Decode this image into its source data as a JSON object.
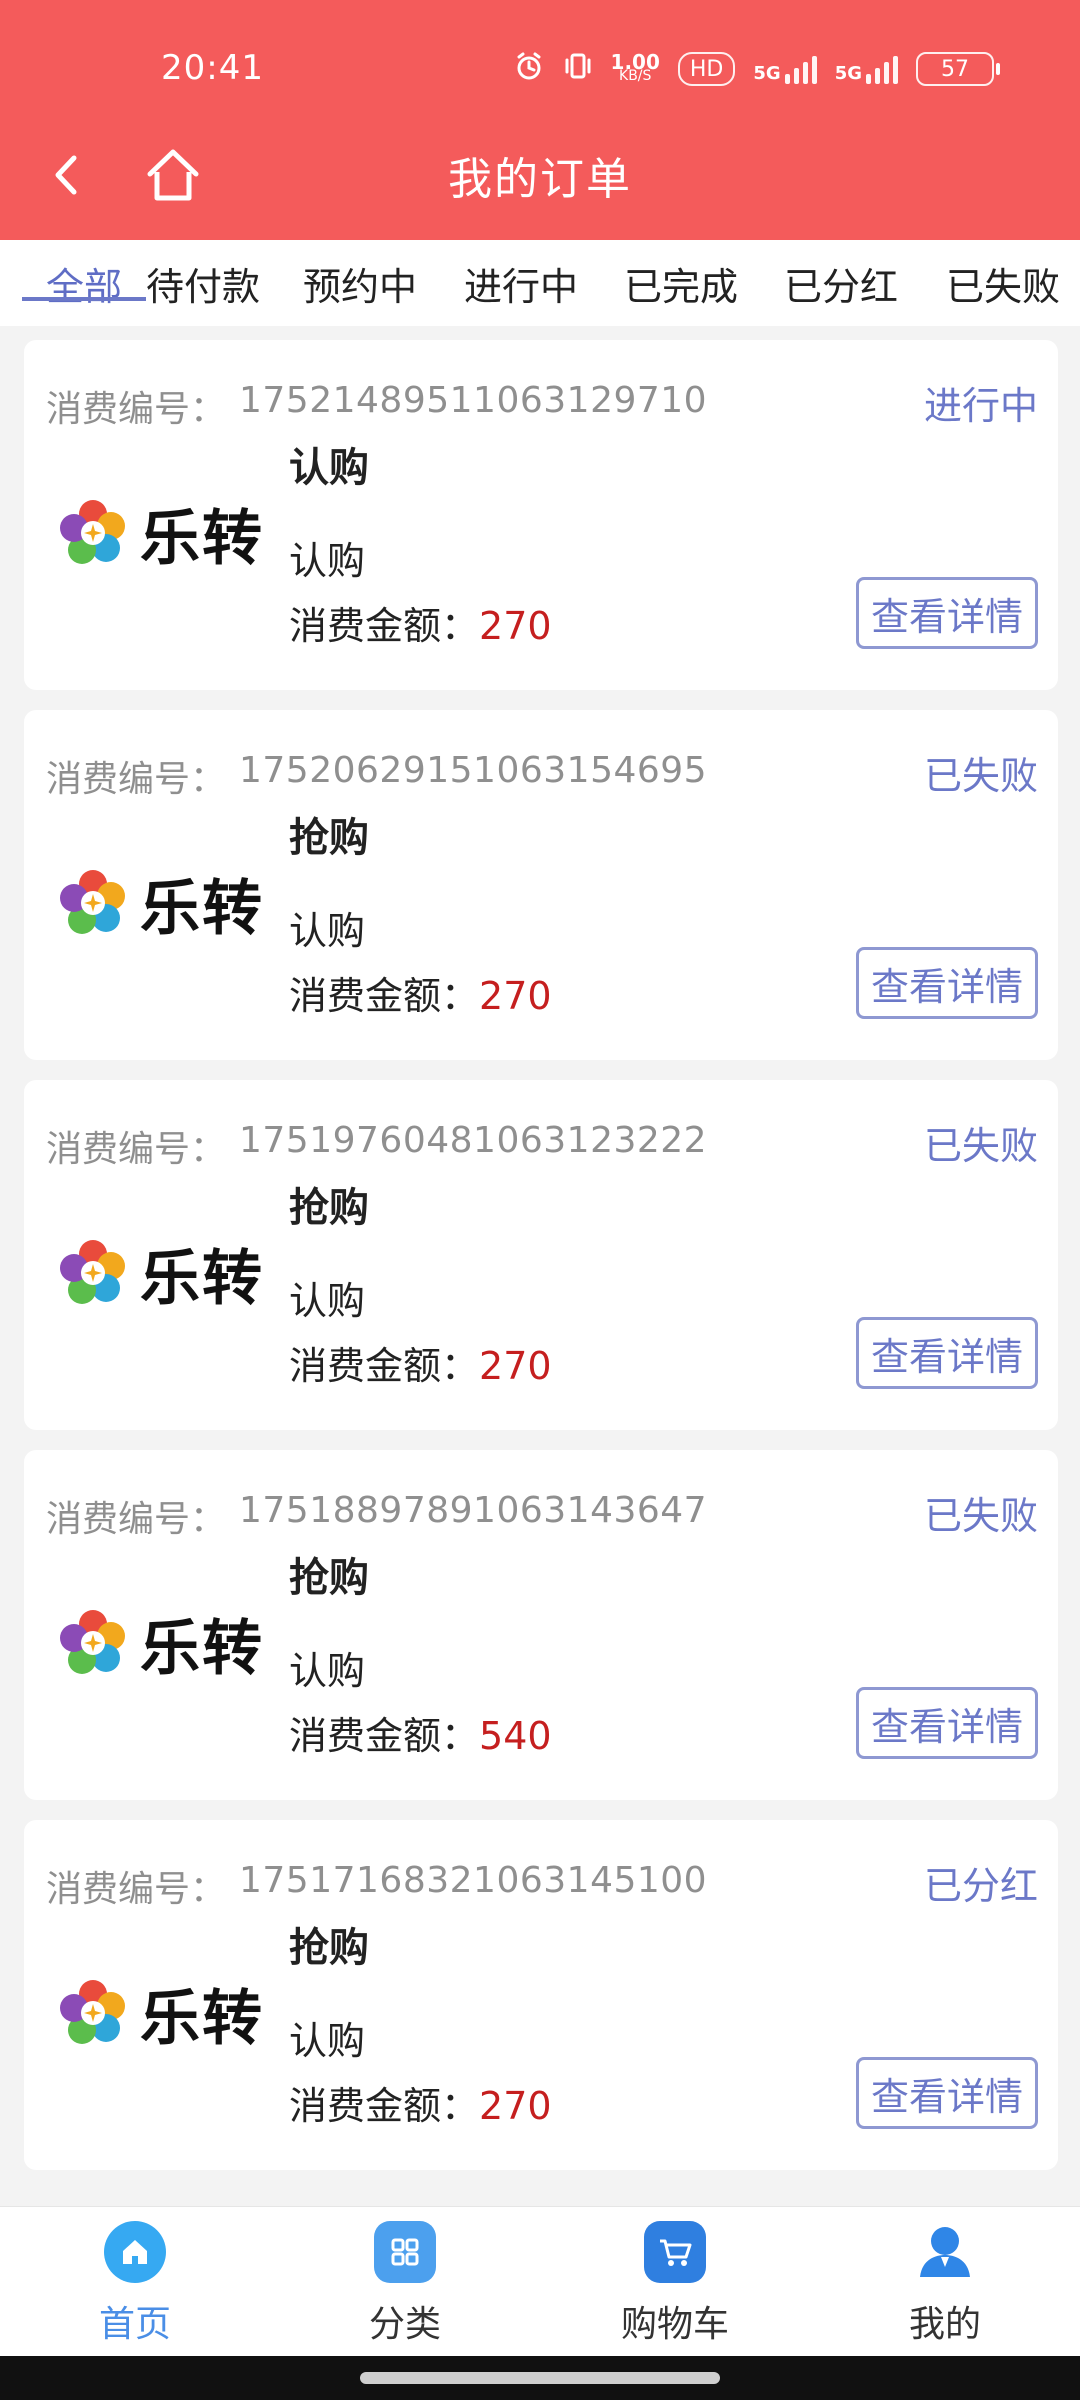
{
  "status_bar": {
    "time": "20:41",
    "network_speed_top": "1.00",
    "network_speed_bottom": "KB/S",
    "hd": "HD",
    "sim1": "5G",
    "sim2": "5G",
    "battery": "57",
    "icons": [
      "alarm-icon",
      "vibrate-icon"
    ]
  },
  "header": {
    "title": "我的订单",
    "back_icon": "chevron-left-icon",
    "home_icon": "home-outline-icon"
  },
  "tabs": [
    {
      "label": "全部",
      "active": true
    },
    {
      "label": "待付款",
      "active": false
    },
    {
      "label": "预约中",
      "active": false
    },
    {
      "label": "进行中",
      "active": false
    },
    {
      "label": "已完成",
      "active": false
    },
    {
      "label": "已分红",
      "active": false
    },
    {
      "label": "已失败",
      "active": false
    }
  ],
  "orders": [
    {
      "order_label": "消费编号：",
      "order_no": "17521489511063129710",
      "status": "进行中",
      "brand": "乐转",
      "title": "认购",
      "subtitle": "认购",
      "amount_label": "消费金额：",
      "amount": "270",
      "button": "查看详情"
    },
    {
      "order_label": "消费编号：",
      "order_no": "17520629151063154695",
      "status": "已失败",
      "brand": "乐转",
      "title": "抢购",
      "subtitle": "认购",
      "amount_label": "消费金额：",
      "amount": "270",
      "button": "查看详情"
    },
    {
      "order_label": "消费编号：",
      "order_no": "17519760481063123222",
      "status": "已失败",
      "brand": "乐转",
      "title": "抢购",
      "subtitle": "认购",
      "amount_label": "消费金额：",
      "amount": "270",
      "button": "查看详情"
    },
    {
      "order_label": "消费编号：",
      "order_no": "17518897891063143647",
      "status": "已失败",
      "brand": "乐转",
      "title": "抢购",
      "subtitle": "认购",
      "amount_label": "消费金额：",
      "amount": "540",
      "button": "查看详情"
    },
    {
      "order_label": "消费编号：",
      "order_no": "17517168321063145100",
      "status": "已分红",
      "brand": "乐转",
      "title": "抢购",
      "subtitle": "认购",
      "amount_label": "消费金额：",
      "amount": "270",
      "button": "查看详情"
    }
  ],
  "bottom_nav": [
    {
      "label": "首页",
      "icon": "home-icon",
      "active": true
    },
    {
      "label": "分类",
      "icon": "grid-icon",
      "active": false
    },
    {
      "label": "购物车",
      "icon": "cart-icon",
      "active": false
    },
    {
      "label": "我的",
      "icon": "user-icon",
      "active": false
    }
  ],
  "colors": {
    "header_bg": "#f45b5b",
    "accent": "#6b78c8",
    "amount": "#c51f1f",
    "nav_active": "#4a8ee6"
  }
}
